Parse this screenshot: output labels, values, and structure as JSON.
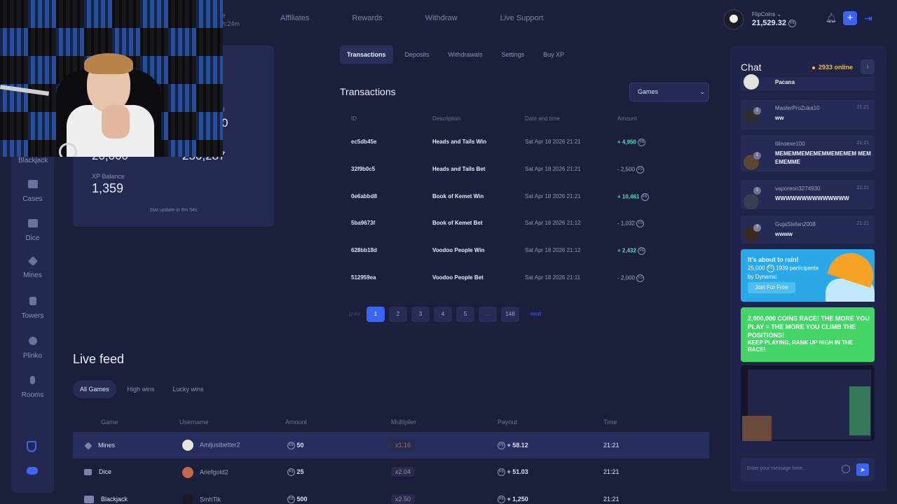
{
  "header": {
    "nav": [
      "Affiliates",
      "Rewards",
      "Withdraw",
      "Live Support"
    ],
    "fragment_top": "ce",
    "fragment_bottom": "0h:24m",
    "user": {
      "name": "FlipCoins",
      "balance": "21,529.32",
      "coin_label": "FS"
    }
  },
  "sidebar": {
    "items": [
      "Blackjack",
      "Cases",
      "Dice",
      "Mines",
      "Towers",
      "Plinko",
      "Rooms"
    ]
  },
  "stats": {
    "val1": "20,000",
    "val2": "250,287",
    "val3": "0",
    "label3": "d",
    "xp_label": "XP Balance",
    "xp_value": "1,359",
    "update": "Stat update in 9m 54s"
  },
  "account_tabs": [
    "Transactions",
    "Deposits",
    "Withdrawals",
    "Settings",
    "Buy XP"
  ],
  "transactions": {
    "title": "Transactions",
    "filter": "Games",
    "headers": [
      "ID",
      "Description",
      "Date and time",
      "Amount"
    ],
    "rows": [
      {
        "id": "ec5db45e",
        "desc": "Heads and Tails Win",
        "date": "Sat Apr 18 2026 21:21",
        "amount": "+ 4,950",
        "positive": true
      },
      {
        "id": "32f9b0c5",
        "desc": "Heads and Tails Bet",
        "date": "Sat Apr 18 2026 21:21",
        "amount": "- 2,500",
        "positive": false
      },
      {
        "id": "0e6abbd8",
        "desc": "Book of Kemet Win",
        "date": "Sat Apr 18 2026 21:21",
        "amount": "+ 10,461",
        "positive": true
      },
      {
        "id": "5ba9673f",
        "desc": "Book of Kemet Bet",
        "date": "Sat Apr 18 2026 21:12",
        "amount": "- 1,032",
        "positive": false
      },
      {
        "id": "628bb18d",
        "desc": "Voodoo People Win",
        "date": "Sat Apr 18 2026 21:12",
        "amount": "+ 2,432",
        "positive": true
      },
      {
        "id": "512959ea",
        "desc": "Voodoo People Bet",
        "date": "Sat Apr 18 2026 21:11",
        "amount": "- 2,000",
        "positive": false
      }
    ],
    "pagination": {
      "prev": "prev",
      "pages": [
        "1",
        "2",
        "3",
        "4",
        "5",
        "...",
        "148"
      ],
      "next": "next"
    }
  },
  "live_feed": {
    "title": "Live feed",
    "tabs": [
      "All Games",
      "High wins",
      "Lucky wins"
    ],
    "headers": [
      "Game",
      "Username",
      "Amount",
      "Multiplier",
      "Payout",
      "Time"
    ],
    "rows": [
      {
        "game": "Mines",
        "user": "Amljustbetter2",
        "amount": "50",
        "mult": "x1.16",
        "payout": "+ 58.12",
        "time": "21:21"
      },
      {
        "game": "Dice",
        "user": "Ariefgold2",
        "amount": "25",
        "mult": "x2.04",
        "payout": "+ 51.03",
        "time": "21:21"
      },
      {
        "game": "Blackjack",
        "user": "SmhTik",
        "amount": "500",
        "mult": "x2.50",
        "payout": "+ 1,250",
        "time": "21:21"
      }
    ]
  },
  "chat": {
    "title": "Chat",
    "online": "2933 online",
    "partial_message": "Pacana",
    "messages": [
      {
        "user": "MasterProZuka10",
        "time": "21:21",
        "text": "ww",
        "level": "1"
      },
      {
        "user": "tilinoexe100",
        "time": "21:21",
        "text": "MEMEMMEMEMEMMEMEMEM MEMEMEMME",
        "level": "1"
      },
      {
        "user": "vaporeon3274930",
        "time": "21:21",
        "text": "WWWWWWWWWWWWWW",
        "level": "1"
      },
      {
        "user": "GujaStefan2008",
        "time": "21:21",
        "text": "wwww",
        "level": "7"
      }
    ],
    "rain": {
      "title": "It's about to rain!",
      "amount": "25,000",
      "participants": "1939 participants",
      "by": "by Dynamic",
      "button": "Join For Free"
    },
    "race": {
      "title": "2,000,000 COINS RACE! THE MORE YOU PLAY = THE MORE YOU CLIMB THE POSITIONS!",
      "subtitle": "KEEP PLAYING, RANK UP HIGH IN THE RACE!"
    },
    "input_placeholder": "Enter your message here..."
  },
  "colors": {
    "accent": "#3c63f2",
    "positive": "#5fd8b6",
    "online": "#f4b944",
    "bg": "#1b1f3b"
  }
}
